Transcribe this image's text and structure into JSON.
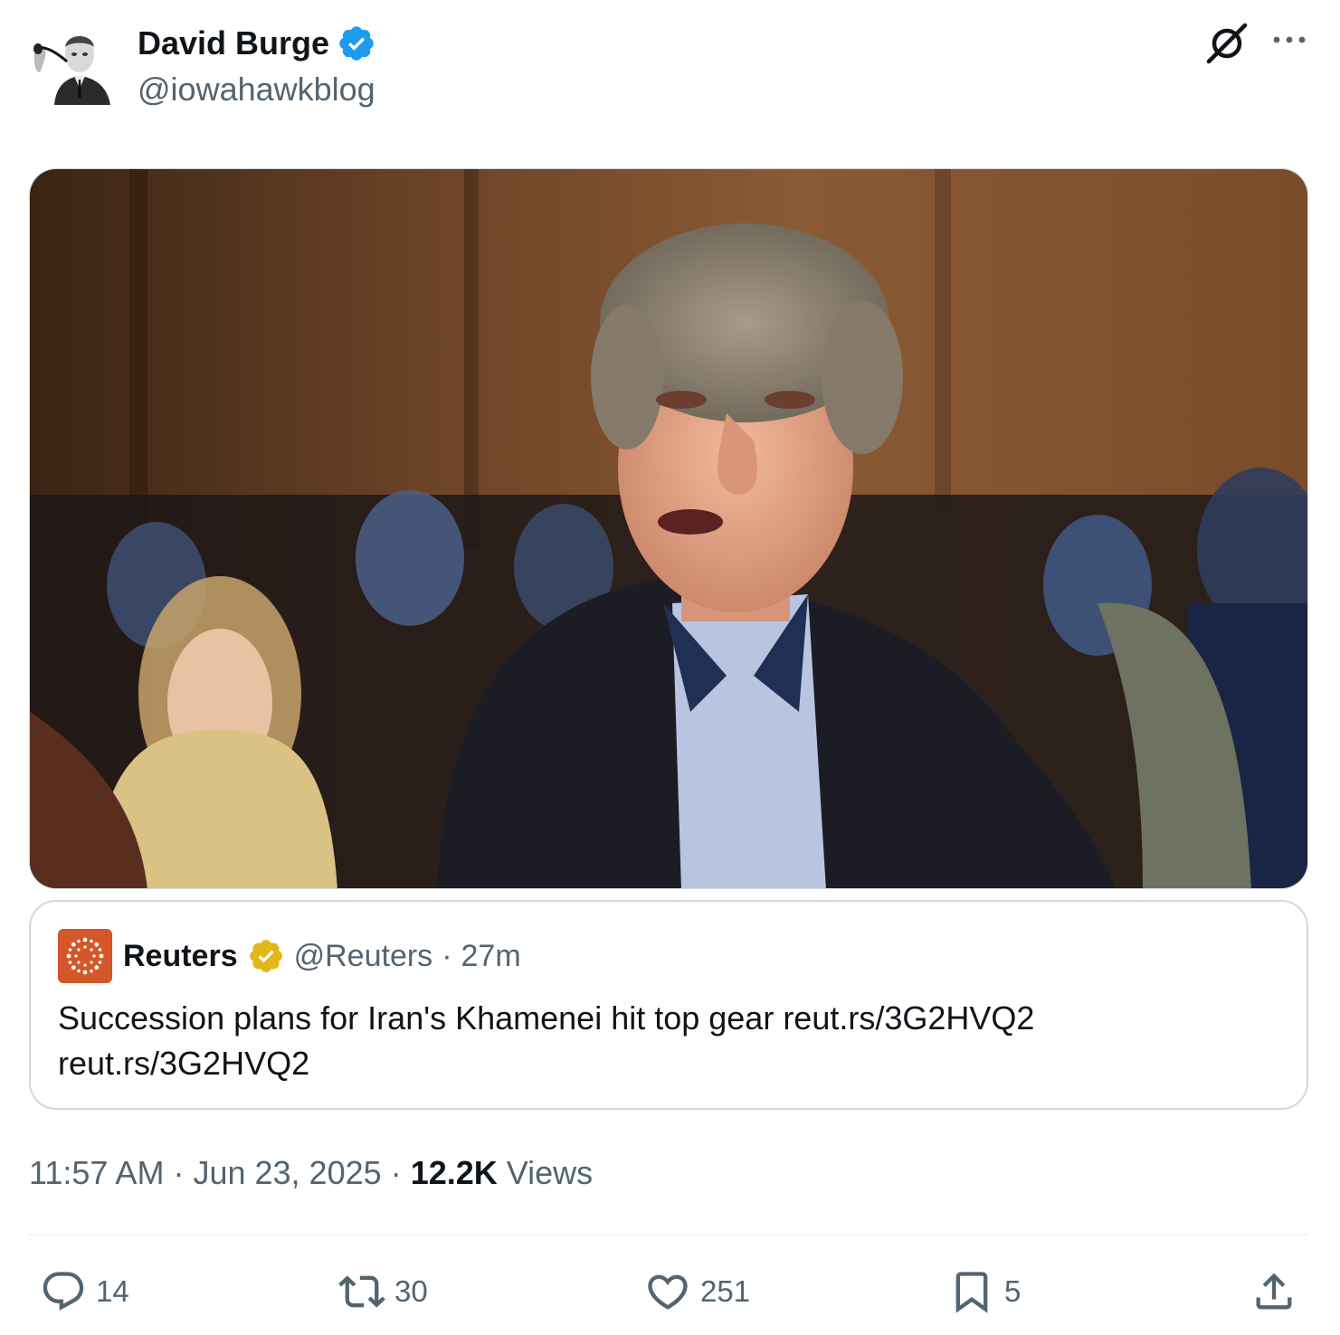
{
  "author": {
    "name": "David Burge",
    "handle": "@iowahawkblog",
    "verified_color": "#1d9bf0"
  },
  "header_icons": {
    "grok": "grok-icon",
    "more": "more-icon"
  },
  "media": {
    "kind": "photo"
  },
  "quote": {
    "name": "Reuters",
    "handle": "@Reuters",
    "separator": "·",
    "time": "27m",
    "text_line1": "Succession plans for Iran's Khamenei hit top gear reut.rs/3G2HVQ2",
    "text_line2": "reut.rs/3G2HVQ2",
    "badge_color": "#e2b719",
    "avatar_color": "#d4572a"
  },
  "meta": {
    "time": "11:57 AM",
    "sep1": "·",
    "date": "Jun 23, 2025",
    "sep2": "·",
    "views_count": "12.2K",
    "views_label": "Views"
  },
  "actions": {
    "replies": "14",
    "reposts": "30",
    "likes": "251",
    "bookmarks": "5"
  },
  "colors": {
    "text_primary": "#0f1419",
    "text_secondary": "#536471",
    "border": "#cfd9de"
  }
}
